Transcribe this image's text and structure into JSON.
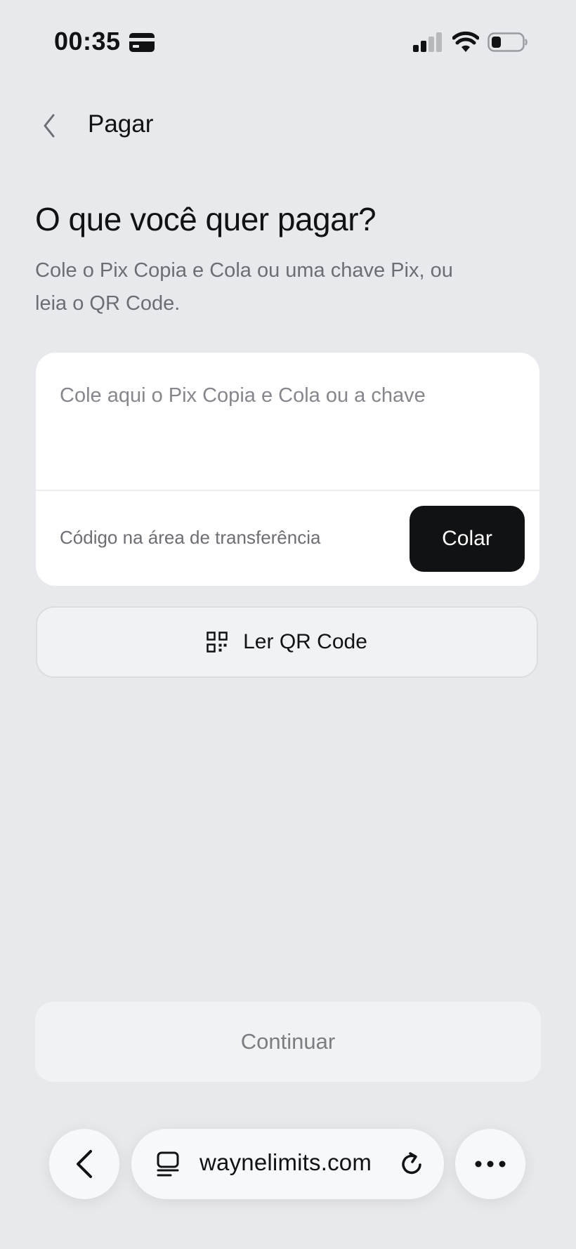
{
  "status_bar": {
    "time": "00:35"
  },
  "header": {
    "title": "Pagar"
  },
  "main": {
    "heading": "O que você quer pagar?",
    "subtitle": "Cole o Pix Copia e Cola ou uma chave Pix, ou leia o QR Code.",
    "input": {
      "placeholder": "Cole aqui o Pix Copia e Cola ou a chave",
      "value": ""
    },
    "clipboard_label": "Código na área de transferência",
    "paste_button": "Colar",
    "qr_button": "Ler QR Code",
    "continue_button": "Continuar"
  },
  "browser": {
    "url": "waynelimits.com"
  },
  "icons": [
    "card-icon",
    "signal-icon",
    "wifi-icon",
    "battery-icon",
    "back-chevron-icon",
    "qr-code-icon",
    "browser-back-icon",
    "tabs-icon",
    "reload-icon",
    "more-icon"
  ],
  "colors": {
    "background": "#e8e9ec",
    "card": "#ffffff",
    "primary_button": "#111214",
    "muted_text": "#6c6e74",
    "disabled_button": "#f1f2f4"
  }
}
